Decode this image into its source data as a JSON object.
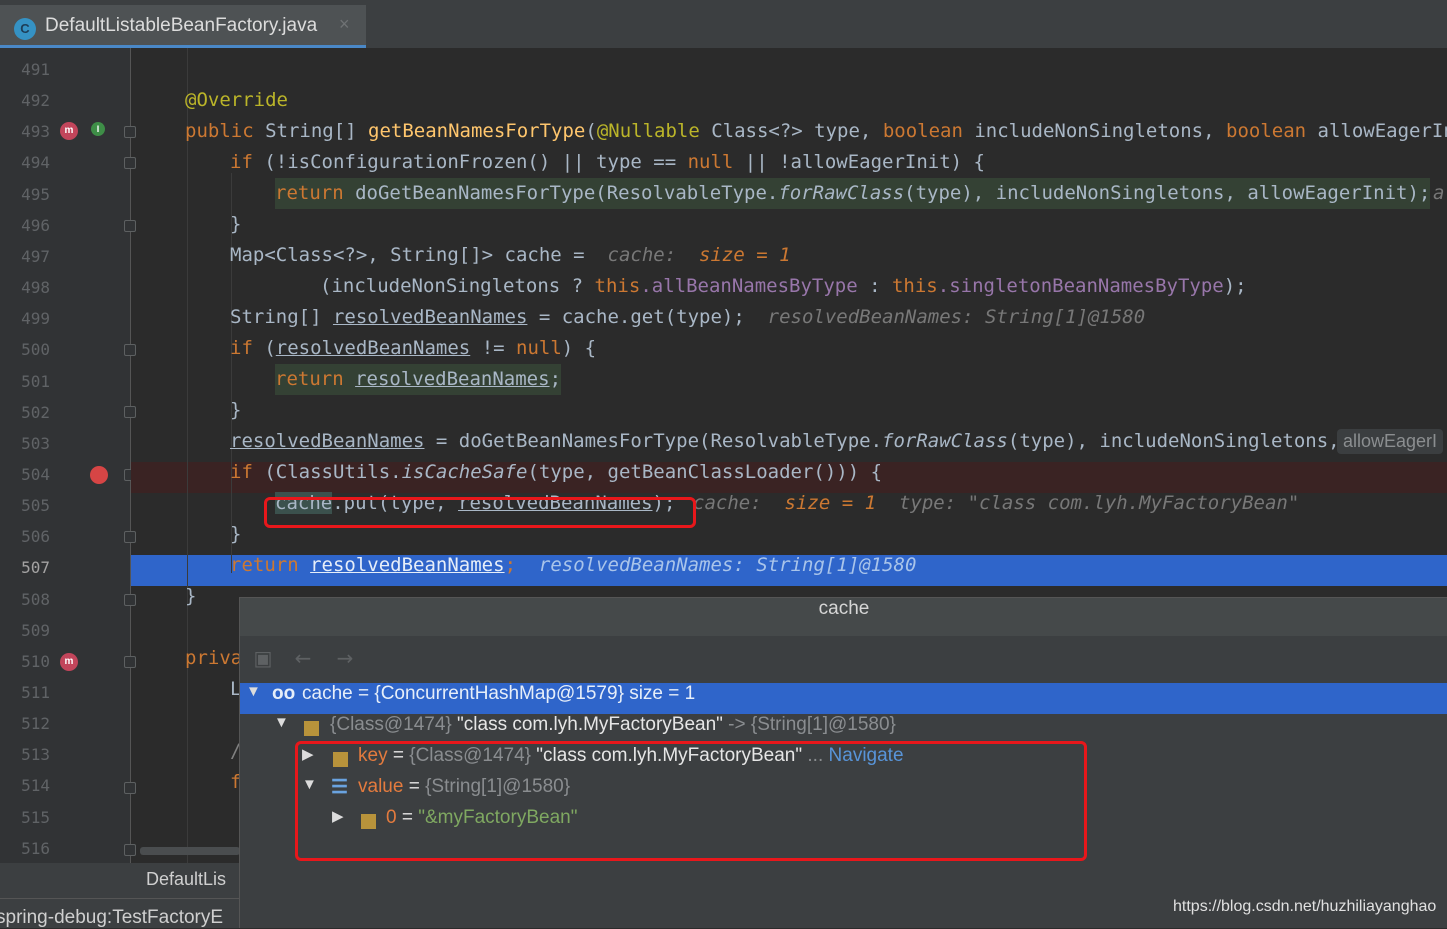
{
  "tab": {
    "icon_letter": "C",
    "title": "DefaultListableBeanFactory.java",
    "close": "×"
  },
  "gutter": {
    "line_numbers": [
      "491",
      "492",
      "493",
      "494",
      "495",
      "496",
      "497",
      "498",
      "499",
      "500",
      "501",
      "502",
      "503",
      "504",
      "505",
      "506",
      "507",
      "508",
      "509",
      "510",
      "511",
      "512",
      "513",
      "514",
      "515",
      "516"
    ],
    "current_line": "507",
    "icon_letter": "m"
  },
  "code": {
    "l492": "@Override",
    "l493_public": "public ",
    "l493_type": "String[] ",
    "l493_method": "getBeanNamesForType",
    "l493_rest1": "(",
    "l493_nullable": "@Nullable",
    "l493_rest2": " Class<?> type, ",
    "l493_boolean": "boolean",
    "l493_rest3": " includeNonSingletons, ",
    "l493_boolean2": "boolean",
    "l493_rest4": " allowEagerIni",
    "l494_if": "if",
    "l494_rest": " (!isConfigurationFrozen() || type == ",
    "l494_null": "null",
    "l494_rest2": " || !allowEagerInit) {",
    "l495_return": "return",
    "l495_rest": " doGetBeanNamesForType(ResolvableType.",
    "l495_it": "forRawClass",
    "l495_rest2": "(type), includeNonSingletons, allowEagerInit);",
    "l495_cut": "a",
    "l496": "}",
    "l497": "Map<Class<?>, String[]> cache = ",
    "l497_hint": "cache: ",
    "l497_hintv": "size = 1",
    "l498_a": "(includeNonSingletons ? ",
    "l498_this1": "this",
    "l498_f1": ".allBeanNamesByType",
    "l498_b": " : ",
    "l498_this2": "this",
    "l498_f2": ".singletonBeanNamesByType",
    "l498_c": ");",
    "l499_a": "String[] ",
    "l499_var": "resolvedBeanNames",
    "l499_b": " = cache.get(type);",
    "l499_hint": "resolvedBeanNames: String[1]@1580",
    "l500_if": "if",
    "l500_a": " (",
    "l500_var": "resolvedBeanNames",
    "l500_b": " != ",
    "l500_null": "null",
    "l500_c": ") {",
    "l501_return": "return",
    "l501_var": "resolvedBeanNames",
    "l501_semi": ";",
    "l502": "}",
    "l503_var": "resolvedBeanNames",
    "l503_a": " = doGetBeanNamesForType(ResolvableType.",
    "l503_it": "forRawClass",
    "l503_b": "(type), includeNonSingletons,",
    "l503_tip": "allowEagerI",
    "l504_if": "if",
    "l504_a": " (ClassUtils.",
    "l504_it": "isCacheSafe",
    "l504_b": "(type, getBeanClassLoader())) {",
    "l505_cache": "cache",
    "l505_a": ".put(type, ",
    "l505_var": "resolvedBeanNames",
    "l505_b": ");",
    "l505_hint": "cache: ",
    "l505_hintv": "size = 1",
    "l505_hint2": "type: \"class com.lyh.MyFactoryBean\"",
    "l506": "}",
    "l507_return": "return",
    "l507_var": "resolvedBeanNames",
    "l507_semi": ";",
    "l507_hint": "resolvedBeanNames: String[1]@1580",
    "l508": "}",
    "l510": "priva",
    "l511": "L",
    "l513": "/",
    "l514": "f"
  },
  "bottom": {
    "editor_tab": "DefaultLis",
    "status": "spring-debug:TestFactoryE"
  },
  "popup": {
    "title": "cache",
    "toolbar": {
      "pin": "▣",
      "back": "←",
      "forward": "→"
    },
    "rows": {
      "root_icon": "oo",
      "root_name": "cache",
      "root_eq": " = ",
      "root_val": "{ConcurrentHashMap@1579}",
      "root_size": "  size = 1",
      "entry_type": "{Class@1474} ",
      "entry_str": "\"class com.lyh.MyFactoryBean\"",
      "entry_arrow": " -> ",
      "entry_val": "{String[1]@1580}",
      "key_name": "key",
      "key_eq": " = ",
      "key_type": "{Class@1474} ",
      "key_str": "\"class com.lyh.MyFactoryBean\"",
      "key_dots": " ... ",
      "key_nav": "Navigate",
      "value_name": "value",
      "value_eq": " = ",
      "value_val": "{String[1]@1580}",
      "item_name": "0",
      "item_eq": " = ",
      "item_val": "\"&myFactoryBean\""
    }
  },
  "watermark": "https://blog.csdn.net/huzhiliayanghao"
}
